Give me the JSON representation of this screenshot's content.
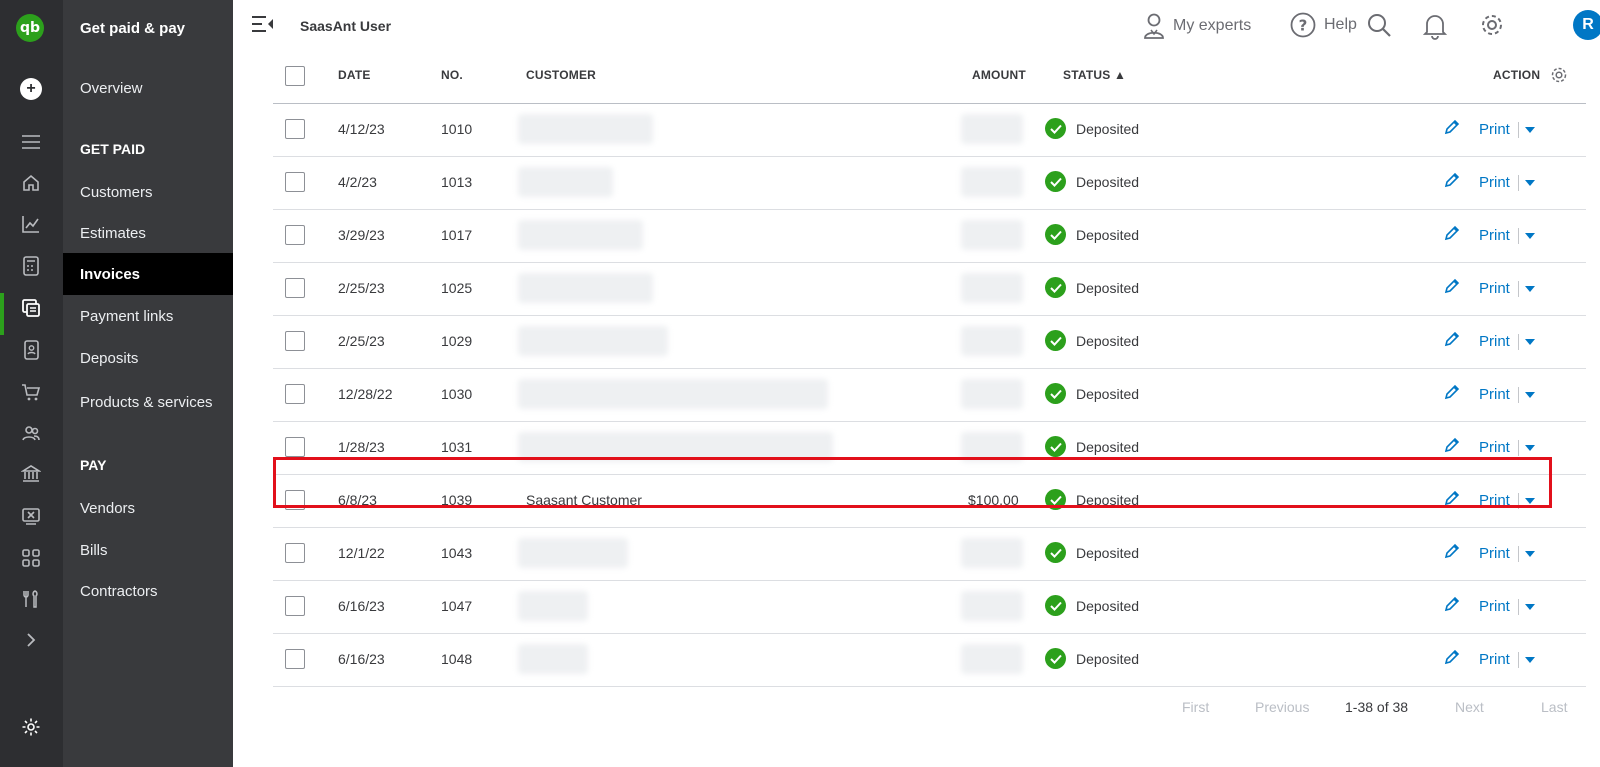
{
  "rail": {
    "icons": [
      "qb-logo-icon",
      "new-icon",
      "menu-icon",
      "home-icon",
      "chart-icon",
      "calculator-icon",
      "invoice-icon",
      "contacts-book-icon",
      "cart-icon",
      "people-icon",
      "bank-icon",
      "tax-icon",
      "apps-icon",
      "tools-icon",
      "expand-icon",
      "settings-icon"
    ]
  },
  "qb_logo_text": "qb",
  "nav": {
    "title": "Get paid & pay",
    "overview": "Overview",
    "get_paid_header": "GET PAID",
    "get_paid_items": [
      "Customers",
      "Estimates",
      "Invoices",
      "Payment links",
      "Deposits",
      "Products & services"
    ],
    "pay_header": "PAY",
    "pay_items": [
      "Vendors",
      "Bills",
      "Contractors"
    ],
    "active": "Invoices"
  },
  "topbar": {
    "company": "SaasAnt User",
    "my_experts": "My experts",
    "help": "Help",
    "avatar_initial": "R"
  },
  "table": {
    "headers": {
      "date": "DATE",
      "no": "NO.",
      "customer": "CUSTOMER",
      "amount": "AMOUNT",
      "status": "STATUS ▲",
      "action": "ACTION"
    },
    "rows": [
      {
        "date": "4/12/23",
        "no": "1010",
        "customer": "",
        "amount": "",
        "status": "Deposited",
        "action": "Print"
      },
      {
        "date": "4/2/23",
        "no": "1013",
        "customer": "",
        "amount": "",
        "status": "Deposited",
        "action": "Print"
      },
      {
        "date": "3/29/23",
        "no": "1017",
        "customer": "",
        "amount": "",
        "status": "Deposited",
        "action": "Print"
      },
      {
        "date": "2/25/23",
        "no": "1025",
        "customer": "",
        "amount": "",
        "status": "Deposited",
        "action": "Print"
      },
      {
        "date": "2/25/23",
        "no": "1029",
        "customer": "",
        "amount": "",
        "status": "Deposited",
        "action": "Print"
      },
      {
        "date": "12/28/22",
        "no": "1030",
        "customer": "",
        "amount": "",
        "status": "Deposited",
        "action": "Print"
      },
      {
        "date": "1/28/23",
        "no": "1031",
        "customer": "",
        "amount": "",
        "status": "Deposited",
        "action": "Print"
      },
      {
        "date": "6/8/23",
        "no": "1039",
        "customer": "Saasant Customer",
        "amount": "$100.00",
        "status": "Deposited",
        "action": "Print"
      },
      {
        "date": "12/1/22",
        "no": "1043",
        "customer": "",
        "amount": "",
        "status": "Deposited",
        "action": "Print"
      },
      {
        "date": "6/16/23",
        "no": "1047",
        "customer": "",
        "amount": "",
        "status": "Deposited",
        "action": "Print"
      },
      {
        "date": "6/16/23",
        "no": "1048",
        "customer": "",
        "amount": "",
        "status": "Deposited",
        "action": "Print"
      }
    ]
  },
  "pagination": {
    "first": "First",
    "previous": "Previous",
    "count": "1-38 of 38",
    "next": "Next",
    "last": "Last"
  },
  "colors": {
    "green": "#2ca01c",
    "link_blue": "#0077c5",
    "rail_bg": "#2d2e31",
    "nav_bg": "#393a3d",
    "highlight_red": "#e2101b"
  }
}
